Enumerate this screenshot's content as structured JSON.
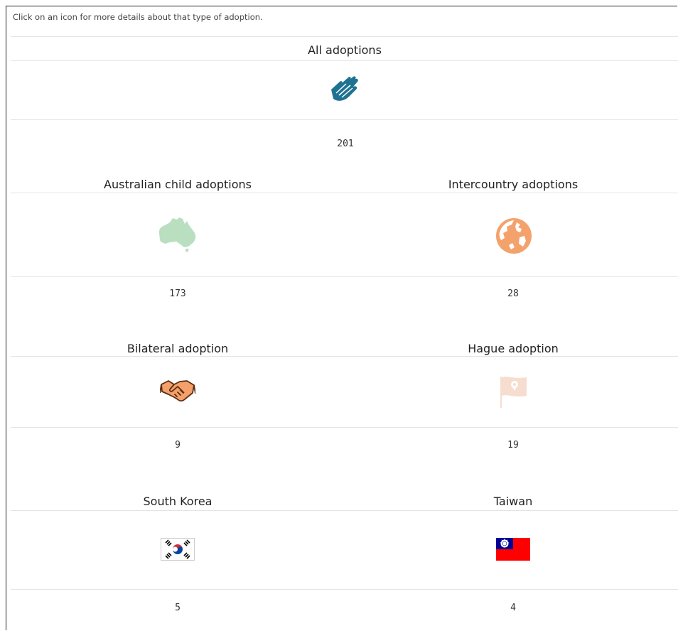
{
  "instruction": "Click on an icon for more details about that type of adoption.",
  "all": {
    "title": "All adoptions",
    "value": "201",
    "icon": "clapping-hands-icon",
    "color": "#1f7391"
  },
  "australian": {
    "title": "Australian child adoptions",
    "value": "173",
    "icon": "australia-map-icon",
    "color": "#b9dfc0"
  },
  "intercountry": {
    "title": "Intercountry adoptions",
    "value": "28",
    "icon": "globe-icon",
    "color": "#f4a26c"
  },
  "bilateral": {
    "title": "Bilateral adoption",
    "value": "9",
    "icon": "handshake-icon",
    "color": "#f3a06a"
  },
  "hague": {
    "title": "Hague adoption",
    "value": "19",
    "icon": "flag-icon",
    "color": "#f6ddd0"
  },
  "south_korea": {
    "title": "South Korea",
    "value": "5",
    "icon": "south-korea-flag-icon"
  },
  "taiwan": {
    "title": "Taiwan",
    "value": "4",
    "icon": "taiwan-flag-icon"
  }
}
